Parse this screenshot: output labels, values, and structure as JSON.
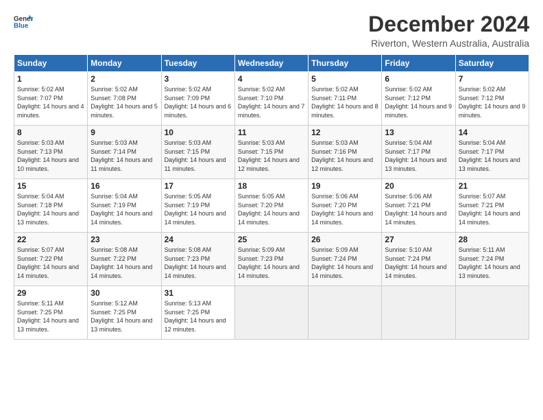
{
  "logo": {
    "general": "General",
    "blue": "Blue"
  },
  "title": "December 2024",
  "subtitle": "Riverton, Western Australia, Australia",
  "weekdays": [
    "Sunday",
    "Monday",
    "Tuesday",
    "Wednesday",
    "Thursday",
    "Friday",
    "Saturday"
  ],
  "weeks": [
    [
      {
        "day": 1,
        "sunrise": "5:02 AM",
        "sunset": "7:07 PM",
        "daylight": "14 hours and 4 minutes."
      },
      {
        "day": 2,
        "sunrise": "5:02 AM",
        "sunset": "7:08 PM",
        "daylight": "14 hours and 5 minutes."
      },
      {
        "day": 3,
        "sunrise": "5:02 AM",
        "sunset": "7:09 PM",
        "daylight": "14 hours and 6 minutes."
      },
      {
        "day": 4,
        "sunrise": "5:02 AM",
        "sunset": "7:10 PM",
        "daylight": "14 hours and 7 minutes."
      },
      {
        "day": 5,
        "sunrise": "5:02 AM",
        "sunset": "7:11 PM",
        "daylight": "14 hours and 8 minutes."
      },
      {
        "day": 6,
        "sunrise": "5:02 AM",
        "sunset": "7:12 PM",
        "daylight": "14 hours and 9 minutes."
      },
      {
        "day": 7,
        "sunrise": "5:02 AM",
        "sunset": "7:12 PM",
        "daylight": "14 hours and 9 minutes."
      }
    ],
    [
      {
        "day": 8,
        "sunrise": "5:03 AM",
        "sunset": "7:13 PM",
        "daylight": "14 hours and 10 minutes."
      },
      {
        "day": 9,
        "sunrise": "5:03 AM",
        "sunset": "7:14 PM",
        "daylight": "14 hours and 11 minutes."
      },
      {
        "day": 10,
        "sunrise": "5:03 AM",
        "sunset": "7:15 PM",
        "daylight": "14 hours and 11 minutes."
      },
      {
        "day": 11,
        "sunrise": "5:03 AM",
        "sunset": "7:15 PM",
        "daylight": "14 hours and 12 minutes."
      },
      {
        "day": 12,
        "sunrise": "5:03 AM",
        "sunset": "7:16 PM",
        "daylight": "14 hours and 12 minutes."
      },
      {
        "day": 13,
        "sunrise": "5:04 AM",
        "sunset": "7:17 PM",
        "daylight": "14 hours and 13 minutes."
      },
      {
        "day": 14,
        "sunrise": "5:04 AM",
        "sunset": "7:17 PM",
        "daylight": "14 hours and 13 minutes."
      }
    ],
    [
      {
        "day": 15,
        "sunrise": "5:04 AM",
        "sunset": "7:18 PM",
        "daylight": "14 hours and 13 minutes."
      },
      {
        "day": 16,
        "sunrise": "5:04 AM",
        "sunset": "7:19 PM",
        "daylight": "14 hours and 14 minutes."
      },
      {
        "day": 17,
        "sunrise": "5:05 AM",
        "sunset": "7:19 PM",
        "daylight": "14 hours and 14 minutes."
      },
      {
        "day": 18,
        "sunrise": "5:05 AM",
        "sunset": "7:20 PM",
        "daylight": "14 hours and 14 minutes."
      },
      {
        "day": 19,
        "sunrise": "5:06 AM",
        "sunset": "7:20 PM",
        "daylight": "14 hours and 14 minutes."
      },
      {
        "day": 20,
        "sunrise": "5:06 AM",
        "sunset": "7:21 PM",
        "daylight": "14 hours and 14 minutes."
      },
      {
        "day": 21,
        "sunrise": "5:07 AM",
        "sunset": "7:21 PM",
        "daylight": "14 hours and 14 minutes."
      }
    ],
    [
      {
        "day": 22,
        "sunrise": "5:07 AM",
        "sunset": "7:22 PM",
        "daylight": "14 hours and 14 minutes."
      },
      {
        "day": 23,
        "sunrise": "5:08 AM",
        "sunset": "7:22 PM",
        "daylight": "14 hours and 14 minutes."
      },
      {
        "day": 24,
        "sunrise": "5:08 AM",
        "sunset": "7:23 PM",
        "daylight": "14 hours and 14 minutes."
      },
      {
        "day": 25,
        "sunrise": "5:09 AM",
        "sunset": "7:23 PM",
        "daylight": "14 hours and 14 minutes."
      },
      {
        "day": 26,
        "sunrise": "5:09 AM",
        "sunset": "7:24 PM",
        "daylight": "14 hours and 14 minutes."
      },
      {
        "day": 27,
        "sunrise": "5:10 AM",
        "sunset": "7:24 PM",
        "daylight": "14 hours and 14 minutes."
      },
      {
        "day": 28,
        "sunrise": "5:11 AM",
        "sunset": "7:24 PM",
        "daylight": "14 hours and 13 minutes."
      }
    ],
    [
      {
        "day": 29,
        "sunrise": "5:11 AM",
        "sunset": "7:25 PM",
        "daylight": "14 hours and 13 minutes."
      },
      {
        "day": 30,
        "sunrise": "5:12 AM",
        "sunset": "7:25 PM",
        "daylight": "14 hours and 13 minutes."
      },
      {
        "day": 31,
        "sunrise": "5:13 AM",
        "sunset": "7:25 PM",
        "daylight": "14 hours and 12 minutes."
      },
      null,
      null,
      null,
      null
    ]
  ]
}
